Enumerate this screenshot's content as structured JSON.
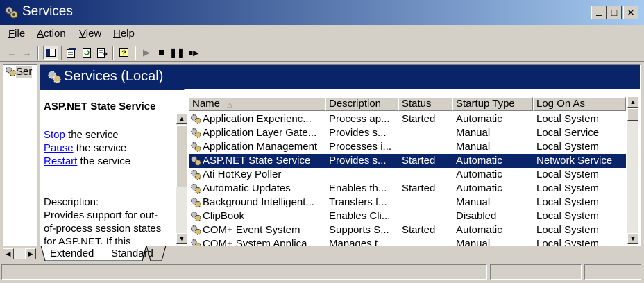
{
  "window": {
    "title": "Services",
    "controls": {
      "minimize": "_",
      "maximize": "□",
      "close": "✕"
    }
  },
  "menu": [
    {
      "label_first": "F",
      "label_rest": "ile"
    },
    {
      "label_first": "A",
      "label_rest": "ction"
    },
    {
      "label_first": "V",
      "label_rest": "iew"
    },
    {
      "label_first": "H",
      "label_rest": "elp"
    }
  ],
  "toolbar": {
    "icons": [
      "back-icon",
      "forward-icon",
      "show-tree-icon",
      "properties-icon",
      "refresh-icon",
      "export-list-icon",
      "help-icon",
      "start-service-icon",
      "stop-service-icon",
      "pause-service-icon",
      "restart-service-icon"
    ]
  },
  "tree": {
    "item": "Ser"
  },
  "header": {
    "title": "Services (Local)"
  },
  "extended": {
    "service_name": "ASP.NET State Service",
    "stop_link": "Stop",
    "stop_rest": " the service",
    "pause_link": "Pause",
    "pause_rest": " the service",
    "restart_link": "Restart",
    "restart_rest": " the service",
    "description_label": "Description:",
    "description_lines": [
      "Provides support for out-",
      "of-process session states",
      "for ASP.NET. If this"
    ]
  },
  "list": {
    "columns": [
      "Name",
      "Description",
      "Status",
      "Startup Type",
      "Log On As"
    ],
    "sort_indicator": "△",
    "rows": [
      {
        "name": "Application Experienc...",
        "description": "Process ap...",
        "status": "Started",
        "startup": "Automatic",
        "logon": "Local System"
      },
      {
        "name": "Application Layer Gate...",
        "description": "Provides s...",
        "status": "",
        "startup": "Manual",
        "logon": "Local Service"
      },
      {
        "name": "Application Management",
        "description": "Processes i...",
        "status": "",
        "startup": "Manual",
        "logon": "Local System"
      },
      {
        "name": "ASP.NET State Service",
        "description": "Provides s...",
        "status": "Started",
        "startup": "Automatic",
        "logon": "Network Service"
      },
      {
        "name": "Ati HotKey Poller",
        "description": "",
        "status": "",
        "startup": "Automatic",
        "logon": "Local System"
      },
      {
        "name": "Automatic Updates",
        "description": "Enables th...",
        "status": "Started",
        "startup": "Automatic",
        "logon": "Local System"
      },
      {
        "name": "Background Intelligent...",
        "description": "Transfers f...",
        "status": "",
        "startup": "Manual",
        "logon": "Local System"
      },
      {
        "name": "ClipBook",
        "description": "Enables Cli...",
        "status": "",
        "startup": "Disabled",
        "logon": "Local System"
      },
      {
        "name": "COM+ Event System",
        "description": "Supports S...",
        "status": "Started",
        "startup": "Automatic",
        "logon": "Local System"
      },
      {
        "name": "COM+ System Applica...",
        "description": "Manages t...",
        "status": "",
        "startup": "Manual",
        "logon": "Local System"
      }
    ],
    "selected_index": 3
  },
  "tabs": [
    "Extended",
    "Standard"
  ],
  "colors": {
    "titlebar_start": "#0a246a",
    "titlebar_end": "#a6caf0",
    "selection": "#0a246a",
    "link": "#0000ff",
    "chrome": "#d4d0c8"
  }
}
